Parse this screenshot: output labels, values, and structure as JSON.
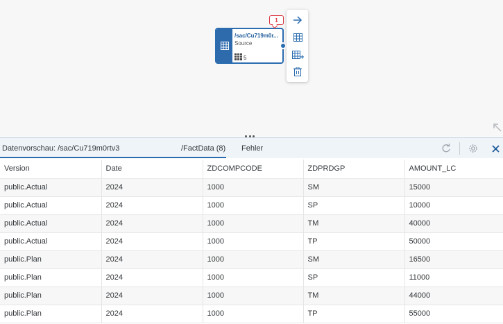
{
  "canvas": {
    "node": {
      "title": "/sac/Cu719m0r...",
      "subtitle": "Source",
      "count": "5",
      "badge": "1"
    },
    "toolbar": {
      "icons": [
        "arrow-right-icon",
        "table-icon",
        "table-add-icon",
        "trash-icon"
      ]
    }
  },
  "panel": {
    "title": "Datenvorschau: /sac/Cu719m0rtv3",
    "tabs": [
      {
        "label": "/FactData (8)",
        "active": true
      },
      {
        "label": "Fehler",
        "active": false
      }
    ],
    "actions": [
      "refresh-icon",
      "settings-icon",
      "close-icon"
    ]
  },
  "table": {
    "columns": [
      "Version",
      "Date",
      "ZDCOMPCODE",
      "ZDPRDGP",
      "AMOUNT_LC"
    ],
    "rows": [
      [
        "public.Actual",
        "2024",
        "1000",
        "SM",
        "15000"
      ],
      [
        "public.Actual",
        "2024",
        "1000",
        "SP",
        "10000"
      ],
      [
        "public.Actual",
        "2024",
        "1000",
        "TM",
        "40000"
      ],
      [
        "public.Actual",
        "2024",
        "1000",
        "TP",
        "50000"
      ],
      [
        "public.Plan",
        "2024",
        "1000",
        "SM",
        "16500"
      ],
      [
        "public.Plan",
        "2024",
        "1000",
        "SP",
        "11000"
      ],
      [
        "public.Plan",
        "2024",
        "1000",
        "TM",
        "44000"
      ],
      [
        "public.Plan",
        "2024",
        "1000",
        "TP",
        "55000"
      ]
    ]
  },
  "colors": {
    "accent": "#2a6cb0",
    "badge": "#d9363e",
    "header_bg": "#eff4f9"
  }
}
